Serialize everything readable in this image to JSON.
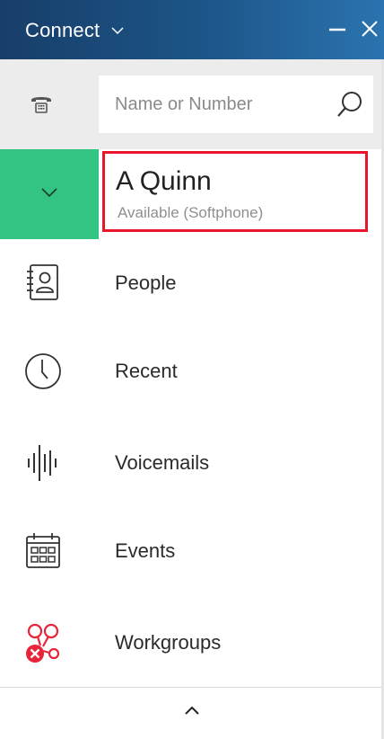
{
  "titlebar": {
    "title": "Connect",
    "menu_icon": "chevron-down-icon",
    "minimize_icon": "minimize-icon",
    "close_icon": "close-icon"
  },
  "search": {
    "placeholder": "Name or Number",
    "value": "",
    "dialpad_icon": "phone-icon",
    "search_icon": "search-icon"
  },
  "status": {
    "name": "A Quinn",
    "availability": "Available (Softphone)",
    "toggle_icon": "chevron-down-icon",
    "colors": {
      "available": "#33c483",
      "highlight_border": "#e8152b"
    }
  },
  "nav": {
    "items": [
      {
        "label": "People",
        "icon": "contacts-book-icon"
      },
      {
        "label": "Recent",
        "icon": "clock-icon"
      },
      {
        "label": "Voicemails",
        "icon": "voicemail-waveform-icon"
      },
      {
        "label": "Events",
        "icon": "calendar-icon"
      },
      {
        "label": "Workgroups",
        "icon": "workgroups-icon"
      }
    ]
  },
  "footer": {
    "collapse_icon": "chevron-up-icon"
  },
  "colors": {
    "titlebar_start": "#173e69",
    "titlebar_end": "#2b74b0",
    "search_row_bg": "#ececec",
    "workgroups_accent": "#e8243b"
  }
}
